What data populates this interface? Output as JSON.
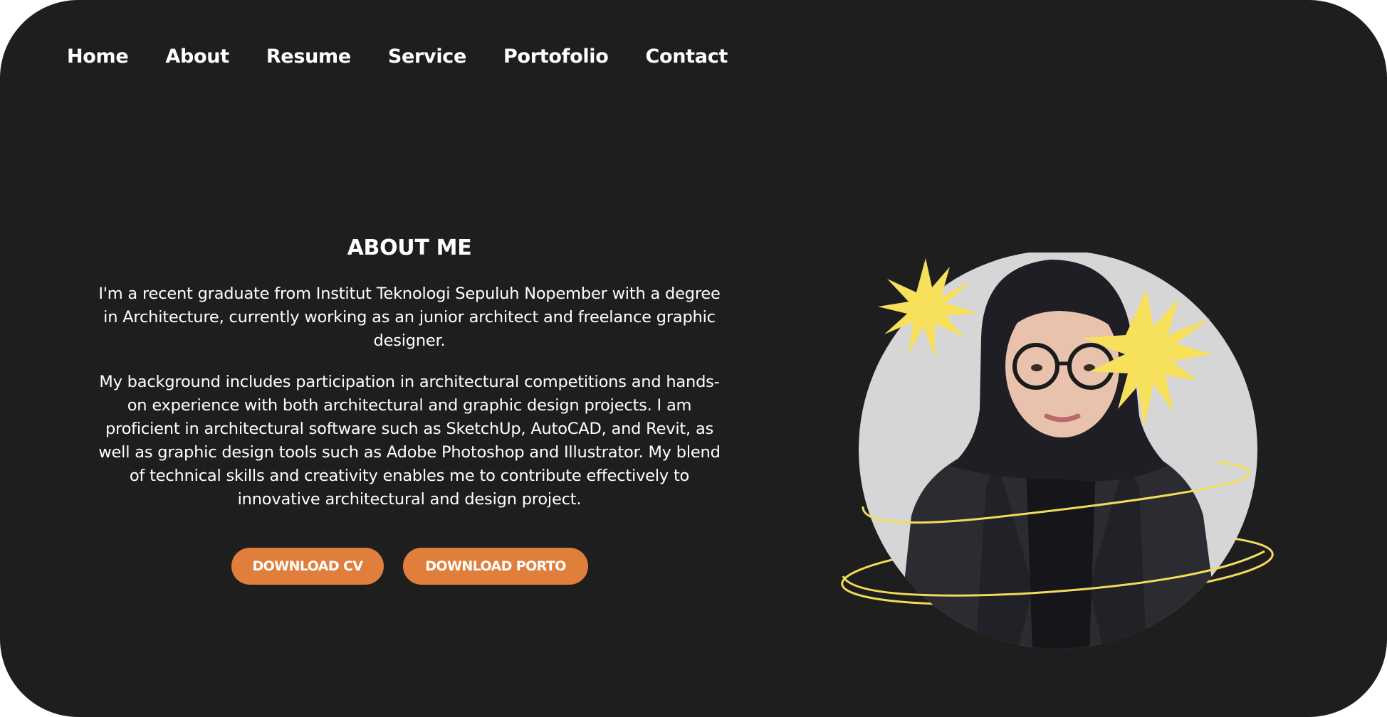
{
  "nav": {
    "items": [
      {
        "label": "Home"
      },
      {
        "label": "About"
      },
      {
        "label": "Resume"
      },
      {
        "label": "Service"
      },
      {
        "label": "Portofolio"
      },
      {
        "label": "Contact"
      }
    ]
  },
  "about": {
    "title": "ABOUT ME",
    "paragraph_1": "I'm a recent graduate from Institut Teknologi Sepuluh Nopember with a degree in Architecture, currently working as an junior architect and freelance graphic designer.",
    "paragraph_2": "My background includes participation in architectural competitions and hands-on experience with both architectural and graphic design projects. I am proficient in architectural software such as SketchUp, AutoCAD, and Revit, as well as graphic design tools such as Adobe Photoshop and Illustrator. My blend of technical skills and creativity enables me to contribute effectively to innovative architectural and design project."
  },
  "buttons": {
    "download_cv": "DOWNLOAD CV",
    "download_porto": "DOWNLOAD PORTO"
  },
  "colors": {
    "background": "#1e1e1e",
    "accent_orange": "#e07e3c",
    "star_yellow": "#f6e05c",
    "circle_grey": "#d6d6d6",
    "text": "#ffffff"
  },
  "icons": [
    "star-icon",
    "orbit-ring"
  ]
}
